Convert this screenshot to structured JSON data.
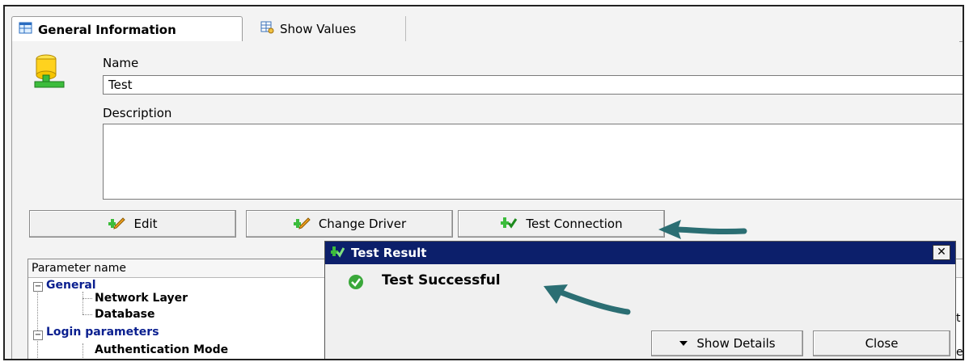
{
  "tabs": [
    {
      "label": "General Information",
      "icon": "table-icon"
    },
    {
      "label": "Show Values",
      "icon": "grid-values-icon"
    }
  ],
  "form": {
    "name_label": "Name",
    "name_value": "Test",
    "description_label": "Description",
    "description_value": ""
  },
  "buttons": {
    "edit": "Edit",
    "change_driver": "Change Driver",
    "test_connection": "Test Connection"
  },
  "grid": {
    "column_header": "Parameter name",
    "rows": [
      {
        "label": "General",
        "kind": "group"
      },
      {
        "label": "Network Layer",
        "kind": "leaf"
      },
      {
        "label": "Database",
        "kind": "leaf"
      },
      {
        "label": "Login parameters",
        "kind": "group"
      },
      {
        "label": "Authentication Mode",
        "kind": "leaf"
      }
    ]
  },
  "dialog": {
    "title": "Test Result",
    "message": "Test Successful",
    "show_details": "Show Details",
    "close": "Close"
  },
  "colors": {
    "dialog_title_bg": "#0c1f6b",
    "group_text": "#0a1f8f",
    "arrow": "#2b6e73",
    "success": "#3aa83a"
  }
}
